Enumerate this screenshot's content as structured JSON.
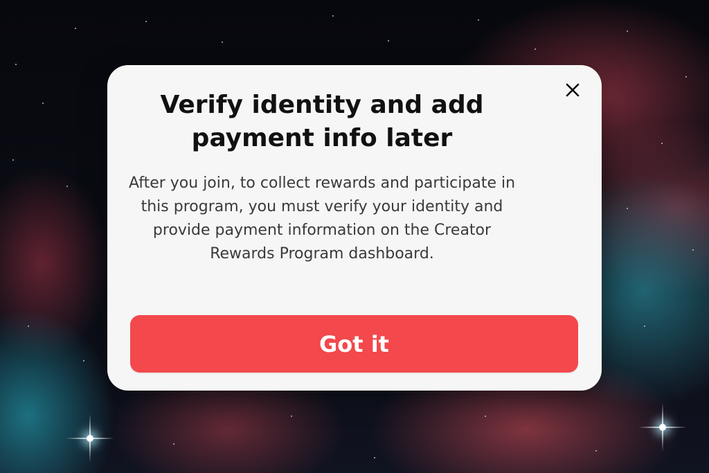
{
  "dialog": {
    "title": "Verify identity and add payment info later",
    "body": "After you join, to collect rewards and participate in this program, you must verify your identity and provide payment information on the Creator Rewards Program dashboard.",
    "primary_button_label": "Got it",
    "close_icon": "close-icon"
  },
  "colors": {
    "primary_button": "#f3484c",
    "dialog_background": "#f6f6f6",
    "title_text": "#111111",
    "body_text": "#3a3a3a"
  }
}
